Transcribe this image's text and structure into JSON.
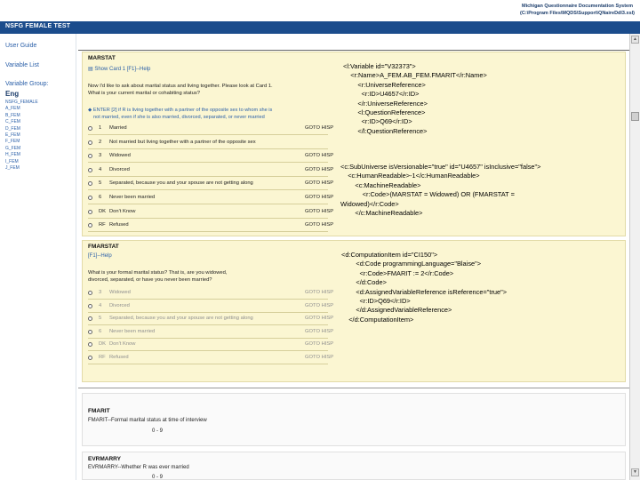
{
  "system": {
    "title_line1": "Michigan Questionnaire Documentation System",
    "title_line2": "(C:\\Program Files\\MQDS\\Support\\QNaireDdl3.xsl)"
  },
  "app_title": "NSFG FEMALE TEST",
  "sidebar": {
    "user_guide": "User Guide",
    "variable_list": "Variable List",
    "variable_group_label": "Variable Group:",
    "variable_group_value": "Eng",
    "groups": [
      "NSFG_FEMALE",
      "A_FEM",
      "B_FEM",
      "C_FEM",
      "D_FEM",
      "E_FEM",
      "F_FEM",
      "G_FEM",
      "H_FEM",
      "I_FEM",
      "J_FEM"
    ]
  },
  "marstat": {
    "name": "MARSTAT",
    "link": "Show Card 1 [F1]--Help",
    "text_line1": "Now I'd like to ask about marital status and living together. Please look at Card 1.",
    "text_line2": "What is your current marital or cohabiting status?",
    "instr_line1": "ENTER [2] if R is living together with a partner of the opposite sex to whom she is",
    "instr_line2": "not married, even if she is also married, divorced, separated, or never married",
    "options": [
      {
        "code": "1",
        "label": "Married",
        "goto": "GOTO HISP"
      },
      {
        "code": "2",
        "label": "Not married but living together with a partner of the opposite sex",
        "goto": ""
      },
      {
        "code": "3",
        "label": "Widowed",
        "goto": "GOTO HISP"
      },
      {
        "code": "4",
        "label": "Divorced",
        "goto": "GOTO HISP"
      },
      {
        "code": "5",
        "label": "Separated, because you and your spouse are not getting along",
        "goto": "GOTO HISP"
      },
      {
        "code": "6",
        "label": "Never been married",
        "goto": "GOTO HISP"
      },
      {
        "code": "DK",
        "label": "Don't Know",
        "goto": "GOTO HISP"
      },
      {
        "code": "RF",
        "label": "Refused",
        "goto": "GOTO HISP"
      }
    ]
  },
  "fmarstat": {
    "name": "FMARSTAT",
    "link": "[F1]--Help",
    "text_line1": "What is your formal marital status? That is, are you widowed,",
    "text_line2": "divorced, separated, or have you never been married?",
    "options": [
      {
        "code": "3",
        "label": "Widowed",
        "goto": "GOTO HISP"
      },
      {
        "code": "4",
        "label": "Divorced",
        "goto": "GOTO HISP"
      },
      {
        "code": "5",
        "label": "Separated, because you and your spouse are not getting along",
        "goto": "GOTO HISP"
      },
      {
        "code": "6",
        "label": "Never been married",
        "goto": "GOTO HISP"
      },
      {
        "code": "DK",
        "label": "Don't Know",
        "goto": "GOTO HISP"
      },
      {
        "code": "RF",
        "label": "Refused",
        "goto": "GOTO HISP"
      }
    ]
  },
  "fmarit": {
    "name": "FMARIT",
    "desc": "FMARIT--Formal marital status at time of interview",
    "range": "0 - 9"
  },
  "evrmarry": {
    "name": "EVRMARRY",
    "desc": "EVRMARRY--Whether R was ever married",
    "range": "0 - 9"
  },
  "xml": {
    "variable": [
      "<l:Variable id=\"V32373\">",
      "    <r:Name>A_FEM.AB_FEM.FMARIT</r:Name>",
      "        <r:UniverseReference>",
      "          <r:ID>U4657</r:ID>",
      "        </r:UniverseReference>",
      "        <l:QuestionReference>",
      "          <r:ID>Q69</r:ID>",
      "        </l:QuestionReference>"
    ],
    "subuniverse": [
      "<c:SubUniverse isVersionable=\"true\" id=\"U4657\" isInclusive=\"false\">",
      "    <c:HumanReadable>-1</c:HumanReadable>",
      "        <c:MachineReadable>",
      "            <r:Code>(MARSTAT = Widowed) OR (FMARSTAT =",
      "Widowed)</r:Code>",
      "        </c:MachineReadable>"
    ],
    "computation": [
      "<d:ComputationItem id=\"CI150\">",
      "        <d:Code programmingLanguage=\"Blaise\">",
      "          <r:Code>FMARIT := 2</r:Code>",
      "        </d:Code>",
      "        <d:AssignedVariableReference isReference=\"true\">",
      "          <r:ID>Q69</r:ID>",
      "        </d:AssignedVariableReference>",
      "    </d:ComputationItem>"
    ]
  }
}
